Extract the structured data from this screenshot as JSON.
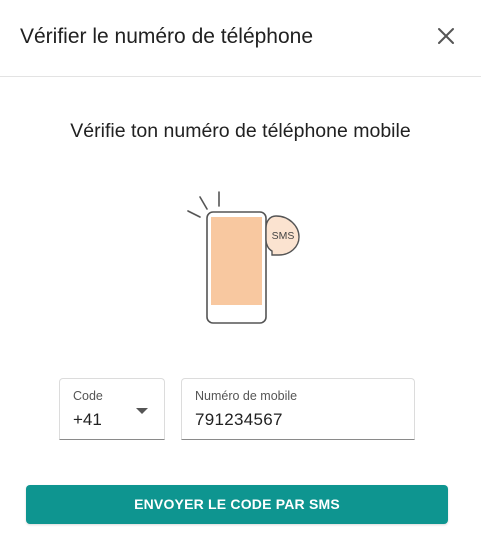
{
  "header": {
    "title": "Vérifier le numéro de téléphone",
    "close_icon": "close-icon"
  },
  "main": {
    "subtitle": "Vérifie ton numéro de téléphone mobile",
    "illustration": {
      "icon": "phone-sms-illustration",
      "bubble_text": "SMS",
      "colors": {
        "screen": "#f8c8a0",
        "bubble": "#fbe3d0",
        "outline": "#555555"
      }
    },
    "form": {
      "code": {
        "label": "Code",
        "value": "+41",
        "icon": "dropdown-arrow-icon"
      },
      "mobile": {
        "label": "Numéro de mobile",
        "value": "791234567"
      },
      "submit_label": "ENVOYER LE CODE PAR SMS"
    }
  },
  "colors": {
    "accent": "#0e9590",
    "divider": "#e3e3e3",
    "text": "#212121"
  }
}
